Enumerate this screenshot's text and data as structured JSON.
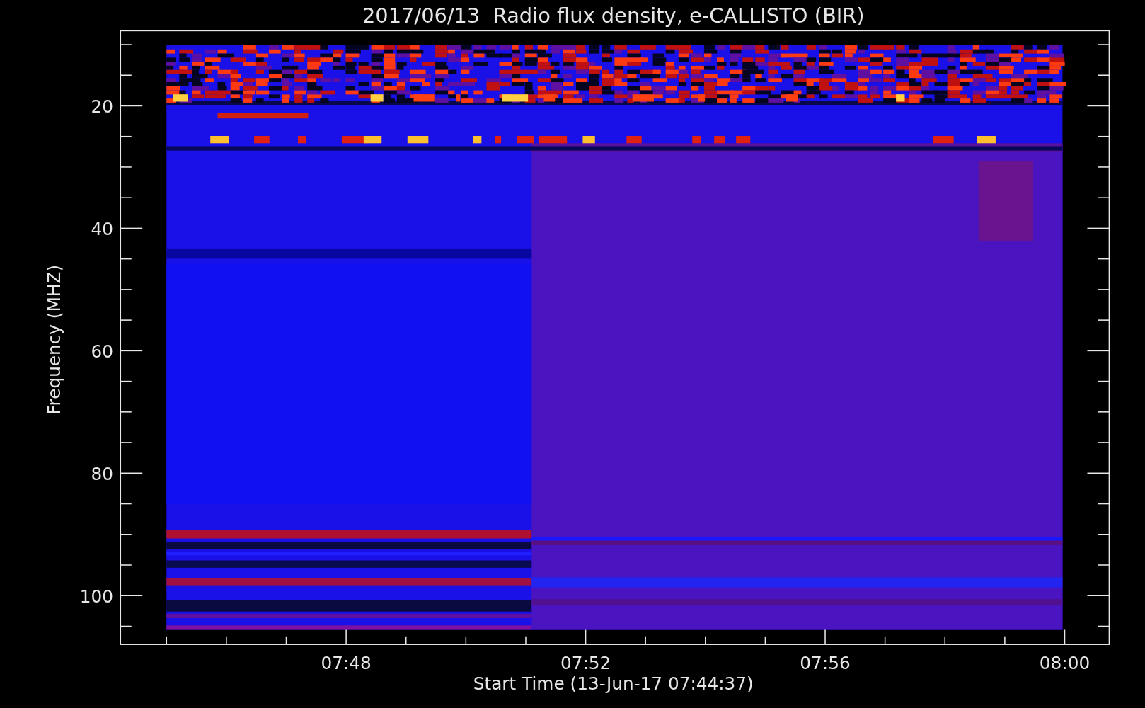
{
  "title": "2017/06/13  Radio flux density, e-CALLISTO (BIR)",
  "y_axis": {
    "label": "Frequency (MHZ)",
    "tick_labels": [
      "20",
      "40",
      "60",
      "80",
      "100"
    ]
  },
  "x_axis": {
    "label": "Start Time (13-Jun-17 07:44:37)",
    "tick_labels": [
      "07:48",
      "07:52",
      "07:56",
      "08:00"
    ]
  }
}
